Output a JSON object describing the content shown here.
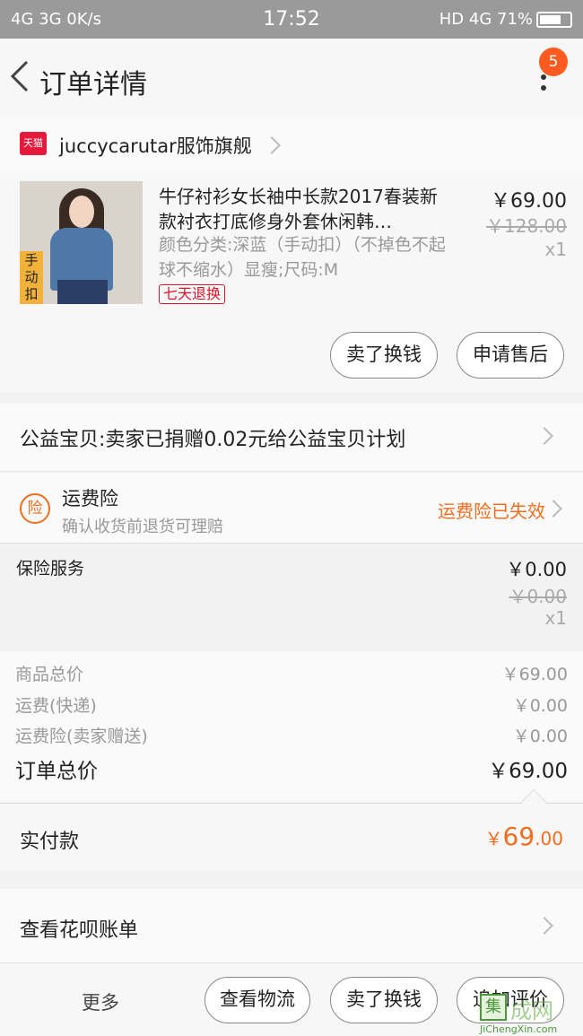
{
  "status_bar": {
    "left": "4G 3G 0K/s",
    "time": "17:52",
    "right": "HD 4G 71%",
    "battery_level": 0.71
  },
  "nav": {
    "title": "订单详情",
    "badge_count": "5"
  },
  "shop": {
    "badge": "天猫",
    "name": "juccycarutar服饰旗舰"
  },
  "product": {
    "thumb_tag": "手动扣",
    "title": "牛仔衬衫女长袖中长款2017春装新款衬衣打底修身外套休闲韩…",
    "spec": "颜色分类:深蓝（手动扣）（不掉色不起球不缩水）显瘦;尺码:M",
    "return_tag": "七天退换",
    "price": "￥69.00",
    "original_price": "￥128.00",
    "quantity": "x1",
    "buttons": [
      "卖了换钱",
      "申请售后"
    ]
  },
  "charity": {
    "text": "公益宝贝:卖家已捐赠0.02元给公益宝贝计划"
  },
  "shipping_insurance": {
    "icon": "险",
    "title": "运费险",
    "subtitle": "确认收货前退货可理赔",
    "status": "运费险已失效",
    "accent": "#f26d1d"
  },
  "insurance_service": {
    "label": "保险服务",
    "price": "￥0.00",
    "original_price": "￥0.00",
    "quantity": "x1"
  },
  "summary": {
    "rows": [
      {
        "label": "商品总价",
        "value": "￥69.00"
      },
      {
        "label": "运费(快递)",
        "value": "￥0.00"
      },
      {
        "label": "运费险(卖家赠送)",
        "value": "￥0.00"
      }
    ],
    "total_label": "订单总价",
    "total_value": "￥69.00"
  },
  "paid": {
    "label": "实付款",
    "currency": "￥",
    "integer": "69",
    "decimal": ".00"
  },
  "huabei": {
    "text": "查看花呗账单"
  },
  "bottom_bar": {
    "more_label": "更多",
    "buttons": [
      "查看物流",
      "卖了换钱",
      "追加评价"
    ]
  },
  "watermark": {
    "icon": "集",
    "text": "成网",
    "url": "JiChengXin.com"
  }
}
